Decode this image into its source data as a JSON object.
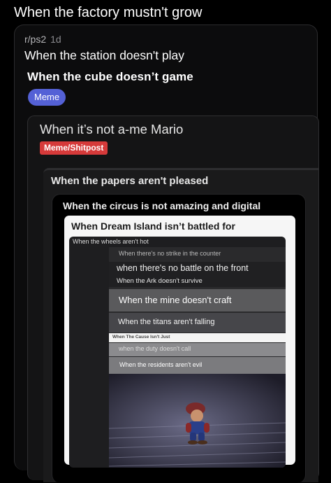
{
  "top_title": "When the factory mustn't grow",
  "post": {
    "subreddit": "r/ps2",
    "age": "1d",
    "title": "When the station doesn't play",
    "inner_title": "When the cube doesn’t game",
    "flair": "Meme"
  },
  "card2": {
    "title": "When it’s not a-me Mario",
    "flair": "Meme/Shitpost"
  },
  "card3": {
    "title": "When the papers aren't pleased"
  },
  "card4": {
    "title": "When the circus is not amazing and digital"
  },
  "card5": {
    "title": "When Dream Island isn’t battled for"
  },
  "card6": {
    "title": "When the wheels aren't hot",
    "rows": [
      "When there's no strike in the counter",
      "when there's no battle on the front",
      "When the Ark doesn't survive",
      "When the mine doesn't craft",
      "When the titans aren't falling",
      "When The Cause Isn't Just",
      "when the duty doesn't call",
      "When the residents aren't evil"
    ]
  },
  "colors": {
    "meme_flair": "#5461d6",
    "shitpost_flair": "#d63a3a",
    "background": "#000000"
  }
}
